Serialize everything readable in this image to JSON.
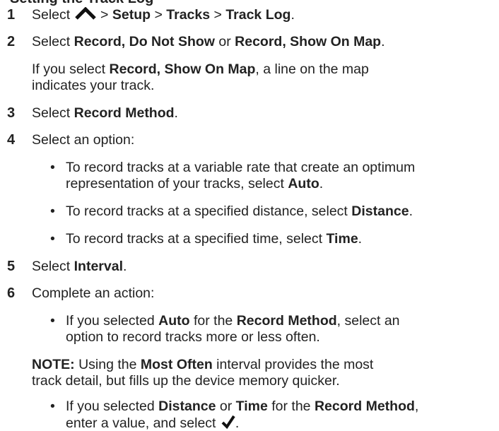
{
  "heading_fragment": "Setting the Track Log",
  "steps": {
    "s1": {
      "num": "1",
      "select": "Select",
      "sep1": ">",
      "setup": "Setup",
      "sep2": ">",
      "tracks": "Tracks",
      "sep3": ">",
      "track_log": "Track Log",
      "end": "."
    },
    "s2": {
      "num": "2",
      "select": "Select",
      "opt1": "Record, Do Not Show",
      "or": "or",
      "opt2": "Record, Show On Map",
      "end": "."
    },
    "s2_note": {
      "pre": "If you select",
      "opt": "Record, Show On Map",
      "post": ", a line on the map",
      "line2": "indicates your track."
    },
    "s3": {
      "num": "3",
      "select": "Select",
      "opt": "Record Method",
      "end": "."
    },
    "s4": {
      "num": "4",
      "text": "Select an option:"
    },
    "s4_b1": {
      "bullet": "•",
      "line1": "To record tracks at a variable rate that create an optimum",
      "line2_pre": "representation of your tracks, select",
      "opt": "Auto",
      "end": "."
    },
    "s4_b2": {
      "bullet": "•",
      "pre": "To record tracks at a specified distance, select",
      "opt": "Distance",
      "end": "."
    },
    "s4_b3": {
      "bullet": "•",
      "pre": "To record tracks at a specified time, select",
      "opt": "Time",
      "end": "."
    },
    "s5": {
      "num": "5",
      "select": "Select",
      "opt": "Interval",
      "end": "."
    },
    "s6": {
      "num": "6",
      "text": "Complete an action:"
    },
    "s6_b1": {
      "bullet": "•",
      "pre": "If you selected",
      "opt1": "Auto",
      "mid": "for the",
      "opt2": "Record Method",
      "post": ", select an",
      "line2": "option to record tracks more or less often."
    },
    "note": {
      "label": "NOTE:",
      "pre": "Using the",
      "opt": "Most Often",
      "post": "interval provides the most",
      "line2": "track detail, but fills up the device memory quicker."
    },
    "s6_b2": {
      "bullet": "•",
      "pre": "If you selected",
      "opt1": "Distance",
      "or": "or",
      "opt2": "Time",
      "mid": "for the",
      "opt3": "Record Method",
      "end": ",",
      "line2": "enter a value, and select",
      "end2": "."
    }
  },
  "icons": {
    "up": "up-chevron-icon",
    "check": "checkmark-icon"
  }
}
